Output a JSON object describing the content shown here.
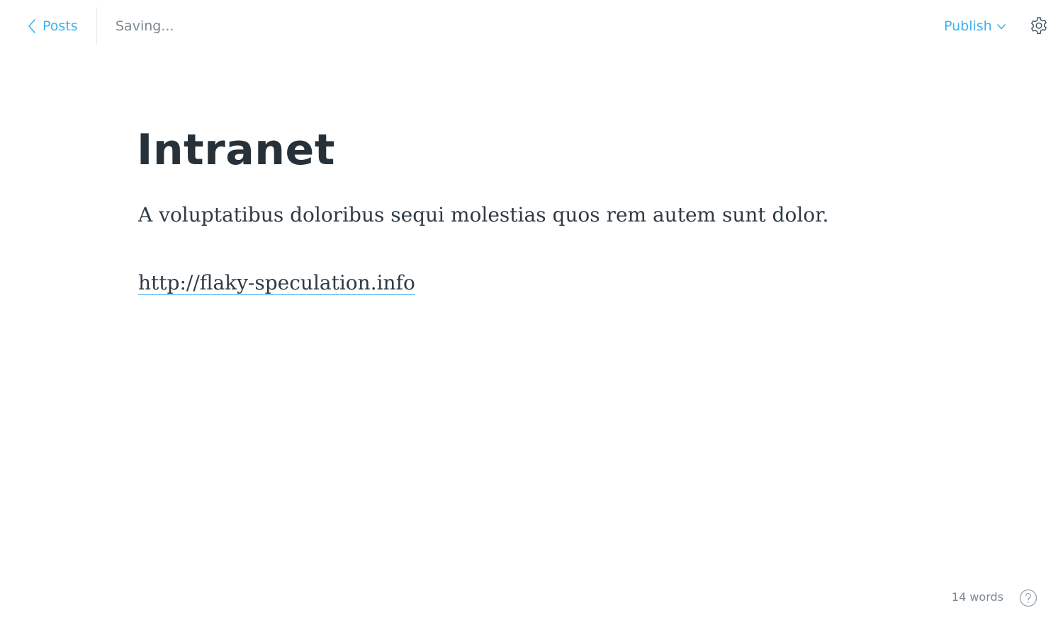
{
  "header": {
    "back_label": "Posts",
    "status_text": "Saving...",
    "publish_label": "Publish"
  },
  "post": {
    "title": "Intranet",
    "paragraph": "A voluptatibus doloribus sequi molestias quos rem autem sunt dolor.",
    "link_text": "http://flaky-speculation.info"
  },
  "footer": {
    "word_count": "14 words"
  },
  "icons": {
    "back": "chevron-left-icon",
    "publish_dropdown": "chevron-down-icon",
    "settings": "gear-icon",
    "help": "question-circle-icon"
  },
  "colors": {
    "accent": "#3eb0ef",
    "title": "#27313a",
    "body_text": "#2f3a42",
    "muted": "#7d878f"
  }
}
